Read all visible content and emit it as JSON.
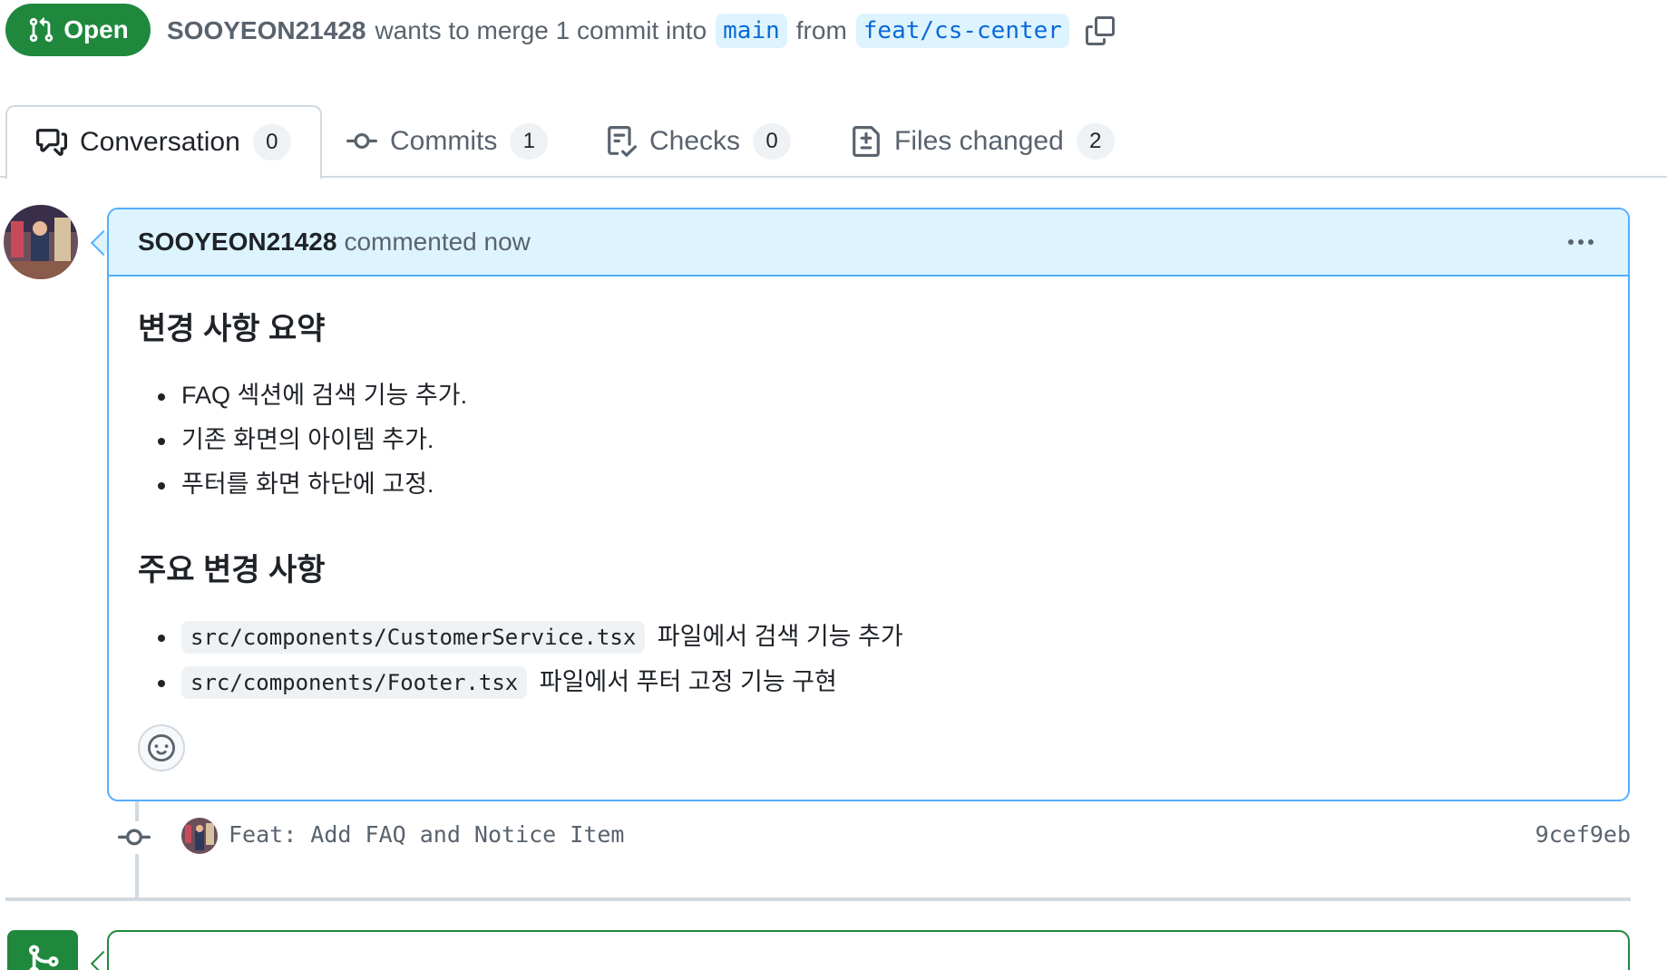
{
  "pr": {
    "state": "Open",
    "author": "SOOYEON21428",
    "merge_text": "wants to merge 1 commit into",
    "base_branch": "main",
    "from_text": "from",
    "head_branch": "feat/cs-center"
  },
  "tabs": [
    {
      "label": "Conversation",
      "count": "0"
    },
    {
      "label": "Commits",
      "count": "1"
    },
    {
      "label": "Checks",
      "count": "0"
    },
    {
      "label": "Files changed",
      "count": "2"
    }
  ],
  "comment": {
    "author": "SOOYEON21428",
    "action": "commented now",
    "heading1": "변경 사항 요약",
    "summary": [
      "FAQ 섹션에 검색 기능 추가.",
      "기존 화면의 아이템 추가.",
      "푸터를 화면 하단에 고정."
    ],
    "heading2": "주요 변경 사항",
    "changes": [
      {
        "code": "src/components/CustomerService.tsx",
        "text": "파일에서 검색 기능 추가"
      },
      {
        "code": "src/components/Footer.tsx",
        "text": "파일에서 푸터 고정 기능 구현"
      }
    ]
  },
  "commit": {
    "message": "Feat: Add FAQ and Notice Item",
    "sha": "9cef9eb"
  },
  "colors": {
    "open_green": "#1f883d",
    "accent_blue": "#0969da",
    "comment_header_bg": "#ddf4ff"
  }
}
